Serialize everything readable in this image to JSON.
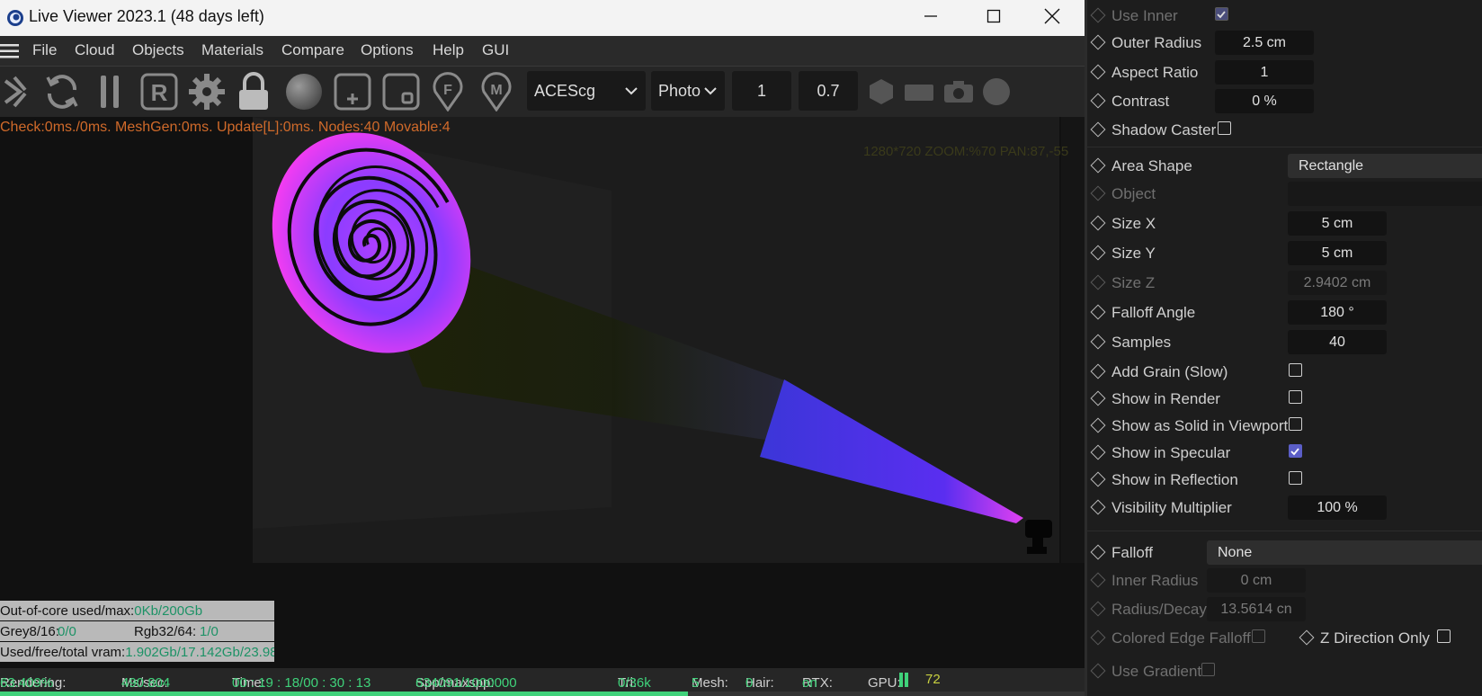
{
  "window": {
    "title": "Live Viewer 2023.1 (48 days left)"
  },
  "menu": {
    "items": [
      "File",
      "Cloud",
      "Objects",
      "Materials",
      "Compare",
      "Options",
      "Help",
      "GUI"
    ]
  },
  "toolbar": {
    "colorspace": "ACEScg",
    "tonemap": "Photo",
    "value1": "1",
    "value2": "0.7",
    "icons": [
      "aperture-icon",
      "refresh-icon",
      "pause-icon",
      "region-render-icon",
      "settings-gear-icon",
      "lock-icon",
      "material-sphere-icon",
      "add-region-icon",
      "focus-region-icon",
      "focus-picker-icon",
      "material-picker-icon",
      "hexagon-icon",
      "rectangle-icon",
      "camera-icon",
      "circle-icon"
    ]
  },
  "viewport": {
    "check_text": "Check:0ms./0ms. MeshGen:0ms. Update[L]:0ms. Nodes:40 Movable:4",
    "zoom_text": "1280*720 ZOOM:%70  PAN:87,-55",
    "stats": {
      "outofcore_label": "Out-of-core used/max:",
      "outofcore_value": "0Kb/200Gb",
      "grey_label": "Grey8/16: ",
      "grey_value": "0/0",
      "rgb_label": "Rgb32/64: ",
      "rgb_value": "1/0",
      "vram_label": "Used/free/total vram: ",
      "vram_value": "1.902Gb/17.142Gb/23.98"
    }
  },
  "status": {
    "rendering_label": "Rendering: ",
    "rendering_value": "63.409%",
    "mssec_label": "Ms/sec: ",
    "mssec_value": "490.804",
    "time_label": "Time: ",
    "time_value": "00 : 19 : 18/00 : 30 : 13",
    "spp_label": "Spp/maxspp: ",
    "spp_value": "634091/1000000",
    "tri_label": "Tri: ",
    "tri_value": "0/36k",
    "mesh_label": "Mesh: ",
    "mesh_value": "5",
    "hair_label": "Hair: ",
    "hair_value": "0",
    "rtx_label": "RTX:",
    "rtx_value": "on",
    "gpu_label": "GPU:",
    "gpu_value": "72",
    "progress_fraction": 0.634
  },
  "attributes": {
    "use_inner": "Use Inner",
    "outer_radius_label": "Outer Radius",
    "outer_radius_value": "2.5 cm",
    "aspect_ratio_label": "Aspect Ratio",
    "aspect_ratio_value": "1",
    "contrast_label": "Contrast",
    "contrast_value": "0 %",
    "shadow_caster_label": "Shadow Caster",
    "area_shape_label": "Area Shape",
    "area_shape_value": "Rectangle",
    "object_label": "Object",
    "size_x_label": "Size X",
    "size_x_value": "5 cm",
    "size_y_label": "Size Y",
    "size_y_value": "5 cm",
    "size_z_label": "Size Z",
    "size_z_value": "2.9402 cm",
    "falloff_angle_label": "Falloff Angle",
    "falloff_angle_value": "180 °",
    "samples_label": "Samples",
    "samples_value": "40",
    "add_grain_label": "Add Grain (Slow)",
    "show_render_label": "Show in Render",
    "show_solid_label": "Show as Solid in Viewport",
    "show_specular_label": "Show in Specular",
    "show_reflection_label": "Show in Reflection",
    "vis_mult_label": "Visibility Multiplier",
    "vis_mult_value": "100 %",
    "falloff_label": "Falloff",
    "falloff_value": "None",
    "inner_radius_label": "Inner Radius",
    "inner_radius_value": "0 cm",
    "radius_decay_label": "Radius/Decay",
    "radius_decay_value": "13.5614 cn",
    "colored_edge_label": "Colored Edge Falloff",
    "z_direction_label": "Z Direction Only",
    "use_gradient_label": "Use Gradient"
  },
  "colors": {
    "accent": "#5b5ec7",
    "status_green": "#3fd27a",
    "warning_orange": "#d06a2a"
  }
}
